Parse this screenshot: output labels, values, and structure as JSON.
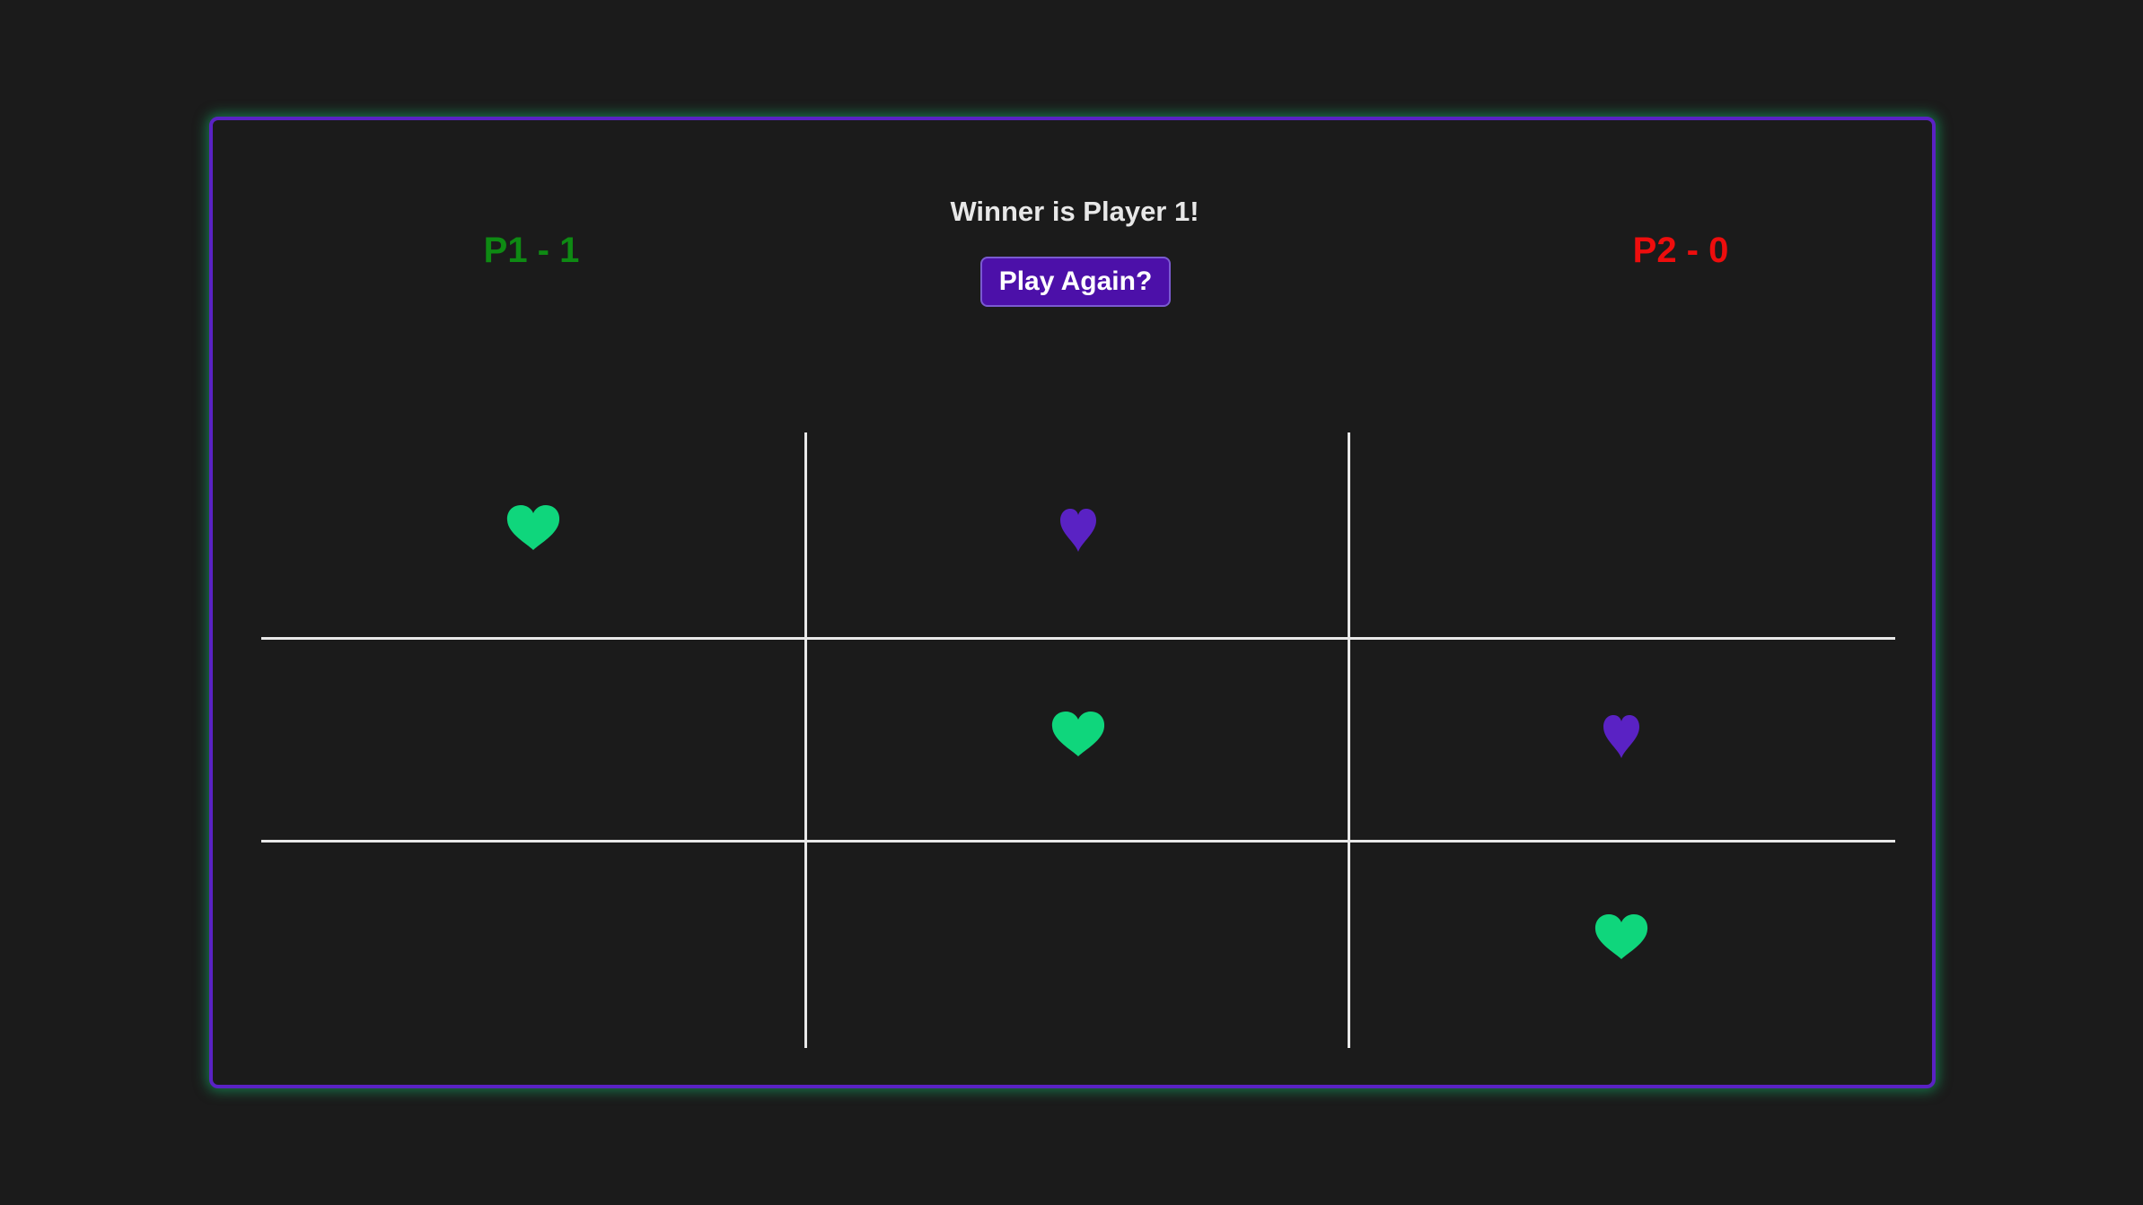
{
  "scoreboard": {
    "p1_label": "P1 - 1",
    "p2_label": "P2 - 0",
    "p1_color": "#0e8a13",
    "p2_color": "#ee0d0d"
  },
  "status": {
    "message": "Winner is Player 1!"
  },
  "controls": {
    "play_again_label": "Play Again?"
  },
  "colors": {
    "background": "#1b1b1b",
    "card_border": "#5a22c4",
    "card_glow": "#14be6e",
    "p1_mark": "#0fd67c",
    "p2_mark": "#5a22c4",
    "grid": "#e8e8e8",
    "button_bg": "#4c10a9"
  },
  "board": {
    "cells": [
      "p1",
      "p2",
      "",
      "",
      "p1",
      "p2",
      "",
      "",
      "p1"
    ],
    "p1_icon": "green-heart-icon",
    "p2_icon": "purple-heart-suit-icon"
  }
}
